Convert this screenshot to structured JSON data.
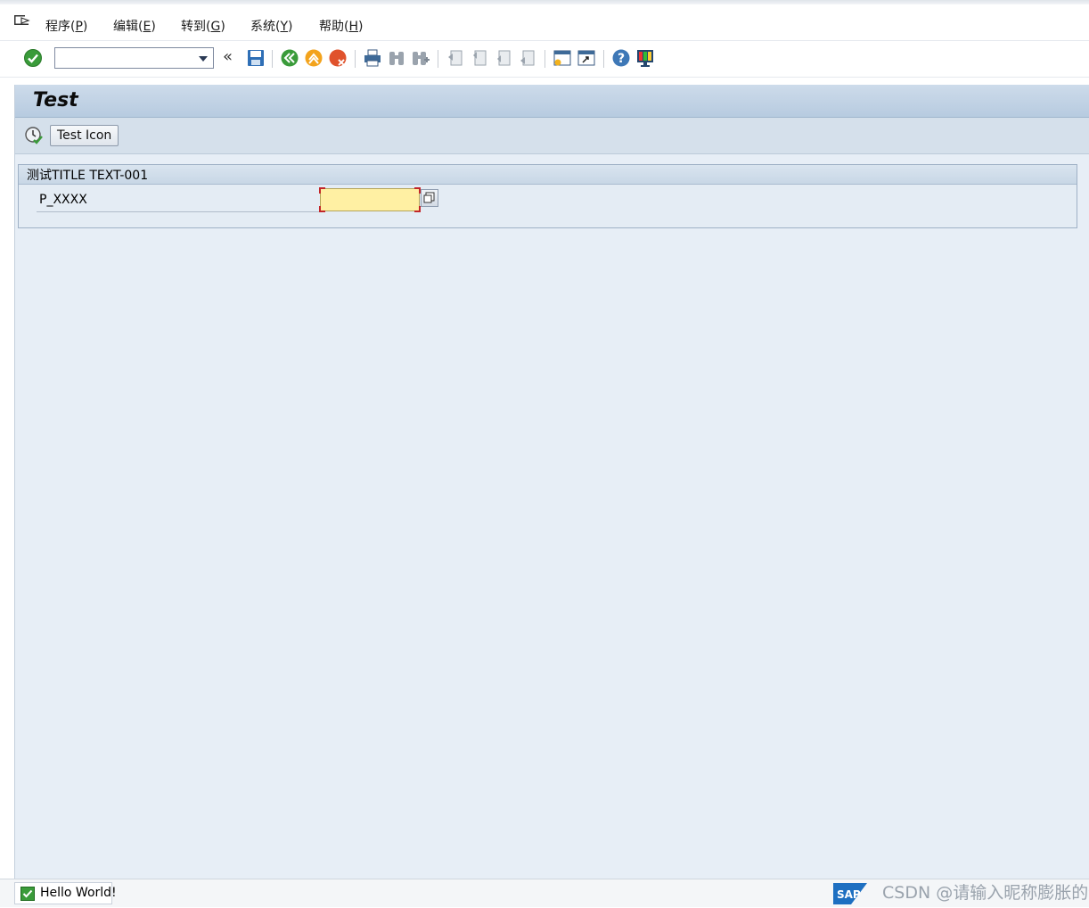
{
  "menu": {
    "items": [
      {
        "label": "程序(",
        "key": "P",
        "close": ")"
      },
      {
        "label": "编辑(",
        "key": "E",
        "close": ")"
      },
      {
        "label": "转到(",
        "key": "G",
        "close": ")"
      },
      {
        "label": "系统(",
        "key": "Y",
        "close": ")"
      },
      {
        "label": "帮助(",
        "key": "H",
        "close": ")"
      }
    ]
  },
  "toolbar": {
    "command_field_value": "",
    "icons": [
      "enter-icon",
      "command-dropdown-icon",
      "collapse-chevron-icon",
      "save-icon",
      "back-icon",
      "exit-icon",
      "cancel-icon",
      "print-icon",
      "find-icon",
      "find-next-icon",
      "first-page-icon",
      "previous-page-icon",
      "next-page-icon",
      "last-page-icon",
      "new-session-icon",
      "shortcut-icon",
      "help-icon",
      "customize-layout-icon"
    ]
  },
  "title": "Test",
  "app_toolbar": {
    "button_label": "Test Icon"
  },
  "selection_frame": {
    "title": "测试TITLE TEXT-001",
    "param_label": "P_XXXX",
    "param_value": ""
  },
  "status": {
    "message": "Hello World!",
    "type": "success"
  },
  "watermark": "CSDN @请输入昵称膨胀的馒头",
  "colors": {
    "title_bar": "#c4d5e7",
    "main_bg": "#e7eef6",
    "input_required": "#fff0a3",
    "success_green": "#3a9b3a"
  }
}
